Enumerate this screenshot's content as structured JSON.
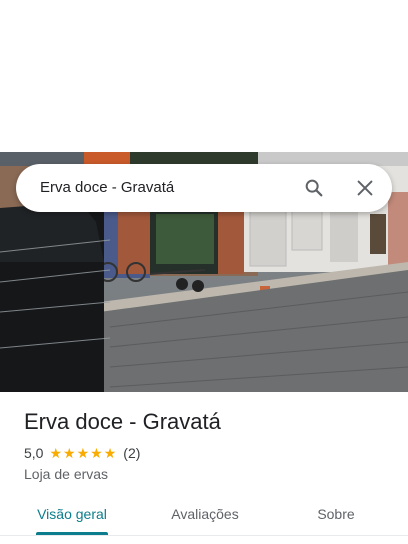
{
  "search": {
    "query": "Erva doce - Gravatá"
  },
  "place": {
    "name": "Erva doce - Gravatá",
    "rating": "5,0",
    "stars": 5,
    "review_count": "(2)",
    "category": "Loja de ervas"
  },
  "tabs": [
    {
      "label": "Visão geral",
      "active": true
    },
    {
      "label": "Avaliações",
      "active": false
    },
    {
      "label": "Sobre",
      "active": false
    }
  ],
  "icons": {
    "search": "search-icon",
    "close": "close-icon",
    "star": "star-icon"
  },
  "colors": {
    "accent": "#0b7d8c",
    "star": "#f9ab00"
  }
}
